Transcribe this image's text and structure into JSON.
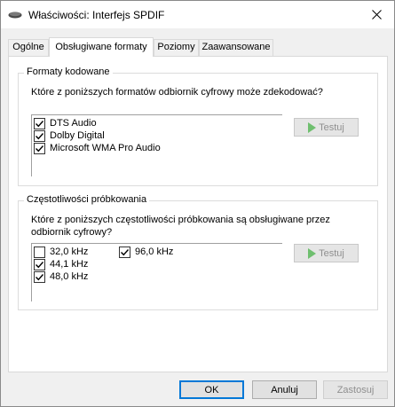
{
  "window": {
    "title": "Właściwości: Interfejs SPDIF",
    "icon": "speaker-device-icon"
  },
  "tabs": [
    {
      "label": "Ogólne",
      "active": false
    },
    {
      "label": "Obsługiwane formaty",
      "active": true
    },
    {
      "label": "Poziomy",
      "active": false
    },
    {
      "label": "Zaawansowane",
      "active": false
    }
  ],
  "encoded_formats": {
    "title": "Formaty kodowane",
    "question": "Które z poniższych formatów odbiornik cyfrowy może zdekodować?",
    "items": [
      {
        "label": "DTS Audio",
        "checked": true
      },
      {
        "label": "Dolby Digital",
        "checked": true
      },
      {
        "label": "Microsoft WMA Pro Audio",
        "checked": true
      }
    ],
    "test_label": "Testuj"
  },
  "sample_rates": {
    "title": "Częstotliwości próbkowania",
    "question_line1": "Które z poniższych częstotliwości próbkowania są obsługiwane przez",
    "question_line2": "odbiornik cyfrowy?",
    "items": [
      {
        "label": "32,0 kHz",
        "checked": false
      },
      {
        "label": "44,1 kHz",
        "checked": true
      },
      {
        "label": "48,0 kHz",
        "checked": true
      },
      {
        "label": "96,0 kHz",
        "checked": true
      }
    ],
    "test_label": "Testuj"
  },
  "footer": {
    "ok_label": "OK",
    "cancel_label": "Anuluj",
    "apply_label": "Zastosuj"
  },
  "colors": {
    "accent": "#0078d7",
    "play_icon": "#6fbf6f"
  }
}
